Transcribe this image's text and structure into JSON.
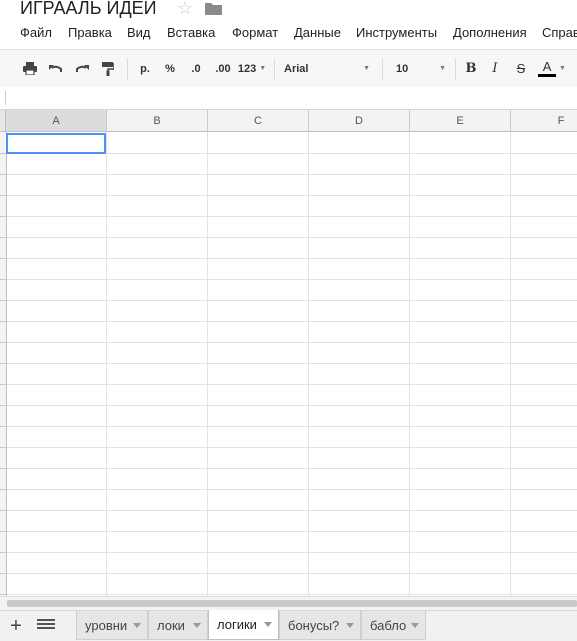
{
  "doc": {
    "title": "ИГРААЛЬ ИДЕИ",
    "star_icon": "star-icon",
    "folder_icon": "folder-icon"
  },
  "menu": [
    "Файл",
    "Правка",
    "Вид",
    "Вставка",
    "Формат",
    "Данные",
    "Инструменты",
    "Дополнения",
    "Справ"
  ],
  "toolbar": {
    "currency": "р.",
    "percent": "%",
    "dec_less": ".0",
    "dec_more": ".00",
    "number_format": "123",
    "font": "Arial",
    "font_size": "10",
    "bold": "B",
    "italic": "I",
    "strike": "S",
    "text_color": "A"
  },
  "grid": {
    "columns": [
      "A",
      "B",
      "C",
      "D",
      "E",
      "F"
    ],
    "selected_cell": "A1"
  },
  "sheets": {
    "tabs": [
      "уровни",
      "локи",
      "логики",
      "бонусы?",
      "бабло"
    ],
    "active": "логики"
  }
}
